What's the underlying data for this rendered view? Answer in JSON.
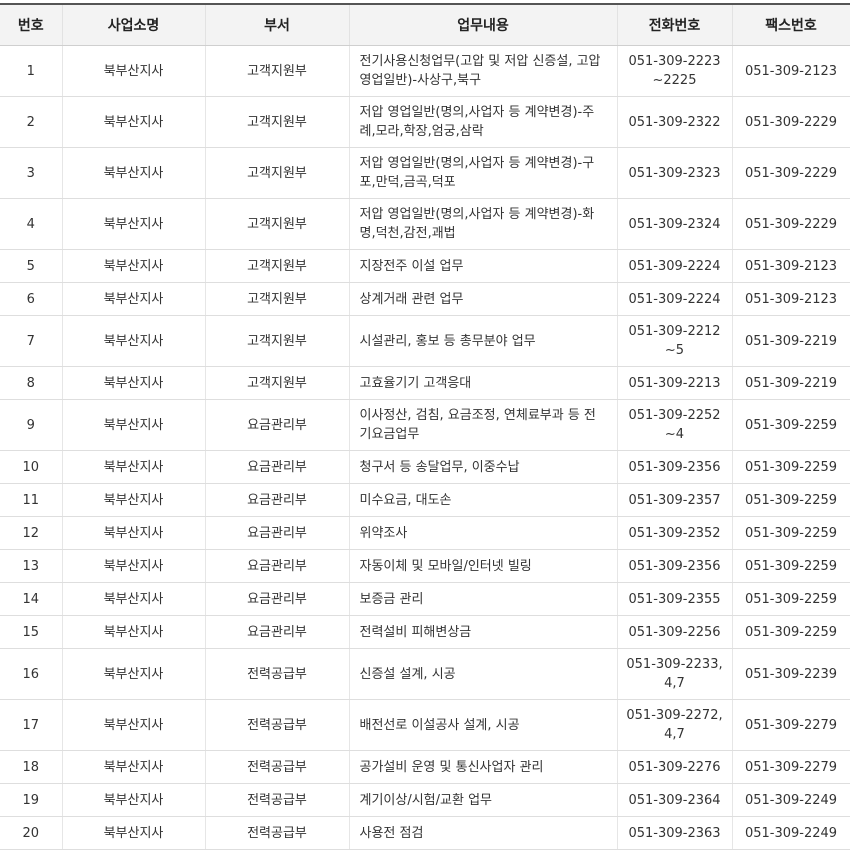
{
  "headers": [
    "번호",
    "사업소명",
    "부서",
    "업무내용",
    "전화번호",
    "팩스번호"
  ],
  "rows": [
    {
      "no": "1",
      "office": "북부산지사",
      "dept": "고객지원부",
      "work": "전기사용신청업무(고압 및 저압 신증설, 고압 영업일반)-사상구,북구",
      "phone": "051-309-2223 ~2225",
      "fax": "051-309-2123",
      "tall": true
    },
    {
      "no": "2",
      "office": "북부산지사",
      "dept": "고객지원부",
      "work": "저압 영업일반(명의,사업자 등 계약변경)-주례,모라,학장,엄궁,삼락",
      "phone": "051-309-2322",
      "fax": "051-309-2229",
      "tall": true
    },
    {
      "no": "3",
      "office": "북부산지사",
      "dept": "고객지원부",
      "work": "저압 영업일반(명의,사업자 등 계약변경)-구포,만덕,금곡,덕포",
      "phone": "051-309-2323",
      "fax": "051-309-2229",
      "tall": true
    },
    {
      "no": "4",
      "office": "북부산지사",
      "dept": "고객지원부",
      "work": "저압 영업일반(명의,사업자 등 계약변경)-화명,덕천,감전,괘법",
      "phone": "051-309-2324",
      "fax": "051-309-2229",
      "tall": true
    },
    {
      "no": "5",
      "office": "북부산지사",
      "dept": "고객지원부",
      "work": "지장전주 이설 업무",
      "phone": "051-309-2224",
      "fax": "051-309-2123",
      "tall": false
    },
    {
      "no": "6",
      "office": "북부산지사",
      "dept": "고객지원부",
      "work": "상계거래 관련 업무",
      "phone": "051-309-2224",
      "fax": "051-309-2123",
      "tall": false
    },
    {
      "no": "7",
      "office": "북부산지사",
      "dept": "고객지원부",
      "work": "시설관리, 홍보 등 총무분야 업무",
      "phone": "051-309-2212 ~5",
      "fax": "051-309-2219",
      "tall": true
    },
    {
      "no": "8",
      "office": "북부산지사",
      "dept": "고객지원부",
      "work": "고효율기기 고객응대",
      "phone": "051-309-2213",
      "fax": "051-309-2219",
      "tall": false
    },
    {
      "no": "9",
      "office": "북부산지사",
      "dept": "요금관리부",
      "work": "이사정산, 검침, 요금조정, 연체료부과 등 전기요금업무",
      "phone": "051-309-2252 ~4",
      "fax": "051-309-2259",
      "tall": true
    },
    {
      "no": "10",
      "office": "북부산지사",
      "dept": "요금관리부",
      "work": "청구서 등 송달업무, 이중수납",
      "phone": "051-309-2356",
      "fax": "051-309-2259",
      "tall": false
    },
    {
      "no": "11",
      "office": "북부산지사",
      "dept": "요금관리부",
      "work": "미수요금, 대도손",
      "phone": "051-309-2357",
      "fax": "051-309-2259",
      "tall": false
    },
    {
      "no": "12",
      "office": "북부산지사",
      "dept": "요금관리부",
      "work": "위약조사",
      "phone": "051-309-2352",
      "fax": "051-309-2259",
      "tall": false
    },
    {
      "no": "13",
      "office": "북부산지사",
      "dept": "요금관리부",
      "work": "자동이체 및 모바일/인터넷 빌링",
      "phone": "051-309-2356",
      "fax": "051-309-2259",
      "tall": false
    },
    {
      "no": "14",
      "office": "북부산지사",
      "dept": "요금관리부",
      "work": "보증금 관리",
      "phone": "051-309-2355",
      "fax": "051-309-2259",
      "tall": false
    },
    {
      "no": "15",
      "office": "북부산지사",
      "dept": "요금관리부",
      "work": "전력설비 피해변상금",
      "phone": "051-309-2256",
      "fax": "051-309-2259",
      "tall": false
    },
    {
      "no": "16",
      "office": "북부산지사",
      "dept": "전력공급부",
      "work": "신증설 설계, 시공",
      "phone": "051-309-2233, 4,7",
      "fax": "051-309-2239",
      "tall": true
    },
    {
      "no": "17",
      "office": "북부산지사",
      "dept": "전력공급부",
      "work": "배전선로 이설공사 설계, 시공",
      "phone": "051-309-2272, 4,7",
      "fax": "051-309-2279",
      "tall": true
    },
    {
      "no": "18",
      "office": "북부산지사",
      "dept": "전력공급부",
      "work": "공가설비 운영 및 통신사업자 관리",
      "phone": "051-309-2276",
      "fax": "051-309-2279",
      "tall": false
    },
    {
      "no": "19",
      "office": "북부산지사",
      "dept": "전력공급부",
      "work": "계기이상/시험/교환 업무",
      "phone": "051-309-2364",
      "fax": "051-309-2249",
      "tall": false
    },
    {
      "no": "20",
      "office": "북부산지사",
      "dept": "전력공급부",
      "work": "사용전 점검",
      "phone": "051-309-2363",
      "fax": "051-309-2249",
      "tall": false
    }
  ]
}
